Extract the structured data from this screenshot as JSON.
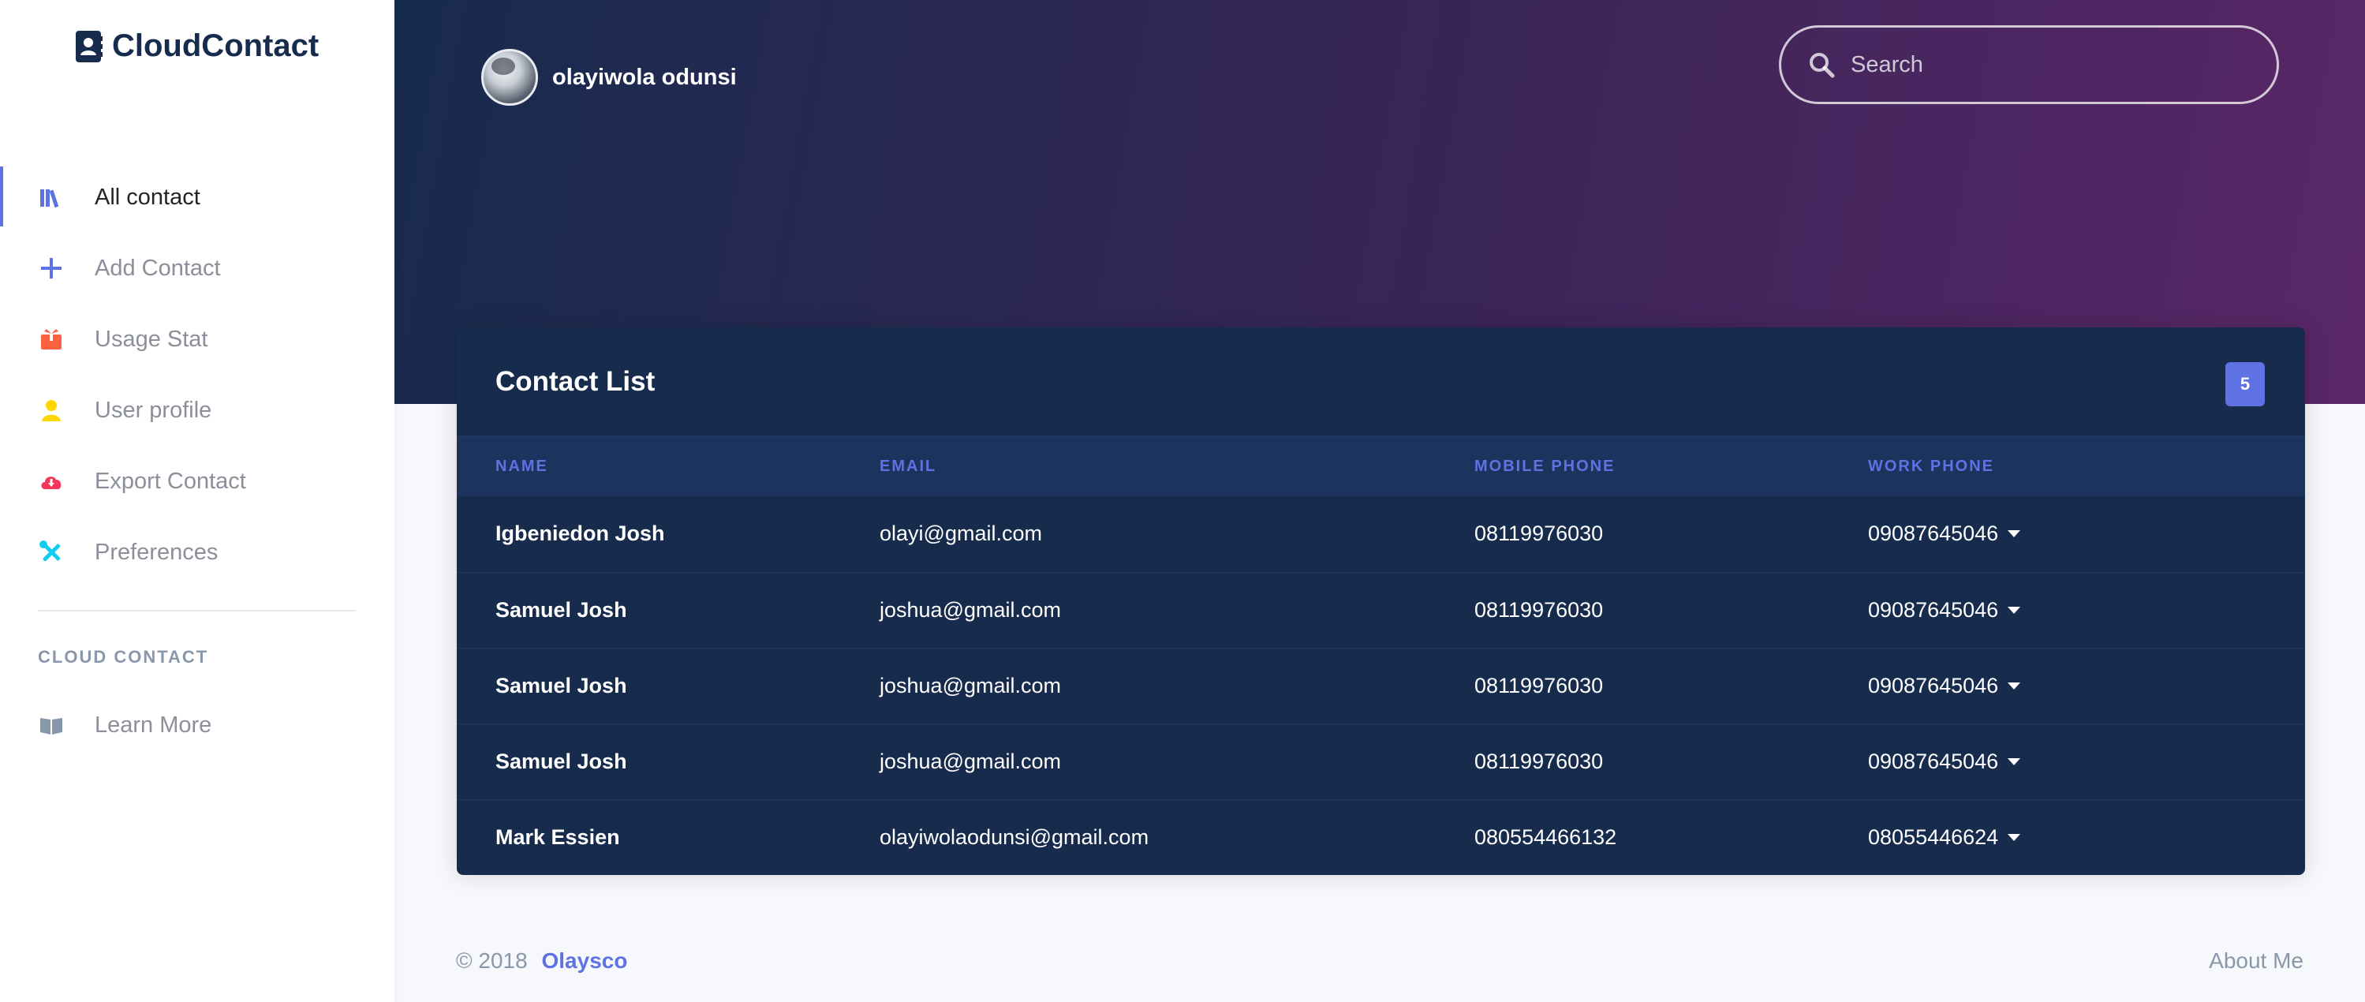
{
  "brand": {
    "name": "CloudContact"
  },
  "sidebar": {
    "items": [
      {
        "label": "All contact",
        "icon": "books-icon",
        "color": "#5e72e4",
        "active": true
      },
      {
        "label": "Add Contact",
        "icon": "plus-icon",
        "color": "#5e72e4"
      },
      {
        "label": "Usage Stat",
        "icon": "gift-box-icon",
        "color": "#fb6340"
      },
      {
        "label": "User profile",
        "icon": "user-icon",
        "color": "#ffd600"
      },
      {
        "label": "Export Contact",
        "icon": "cloud-download-icon",
        "color": "#f5365c"
      },
      {
        "label": "Preferences",
        "icon": "tools-icon",
        "color": "#11cdef"
      }
    ],
    "section_heading": "CLOUD CONTACT",
    "secondary_items": [
      {
        "label": "Learn More",
        "icon": "book-open-icon",
        "color": "#8898aa"
      }
    ]
  },
  "header": {
    "user_name": "olayiwola odunsi",
    "search_placeholder": "Search",
    "gradient": [
      "#172b4d",
      "#5a2767"
    ]
  },
  "contacts": {
    "title": "Contact List",
    "count": "5",
    "columns": [
      "NAME",
      "EMAIL",
      "MOBILE PHONE",
      "WORK PHONE"
    ],
    "rows": [
      {
        "name": "Igbeniedon Josh",
        "email": "olayi@gmail.com",
        "mobile": "08119976030",
        "work": "09087645046"
      },
      {
        "name": "Samuel Josh",
        "email": "joshua@gmail.com",
        "mobile": "08119976030",
        "work": "09087645046"
      },
      {
        "name": "Samuel Josh",
        "email": "joshua@gmail.com",
        "mobile": "08119976030",
        "work": "09087645046"
      },
      {
        "name": "Samuel Josh",
        "email": "joshua@gmail.com",
        "mobile": "08119976030",
        "work": "09087645046"
      },
      {
        "name": "Mark Essien",
        "email": "olayiwolaodunsi@gmail.com",
        "mobile": "080554466132",
        "work": "08055446624"
      }
    ]
  },
  "footer": {
    "copyright": "© 2018",
    "author_link": "Olaysco",
    "about_link": "About Me"
  },
  "colors": {
    "accent": "#5e72e4",
    "card_bg": "#172b4d",
    "page_bg": "#f6f8fc"
  }
}
